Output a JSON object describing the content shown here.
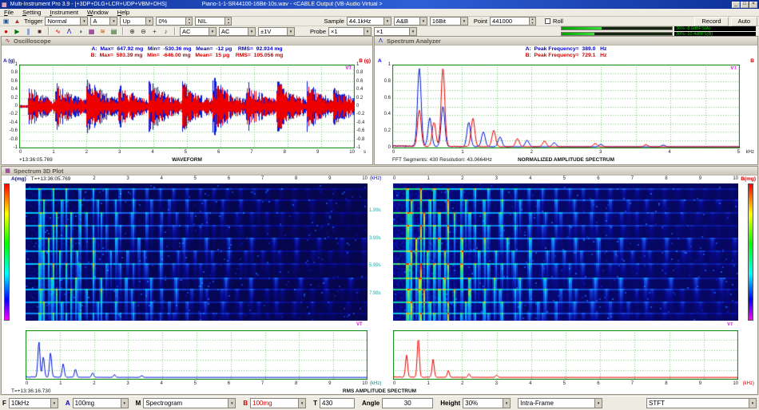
{
  "window": {
    "app_icon": "▦",
    "title": "Multi-Instrument Pro 3.9   - [+3DP+DLG+LCR+UDP+VBM+DHS]",
    "file": "Piano-1-1-SR44100-16Bit-10s.wav  - <CABLE Output (VB-Audio Virtual >",
    "min": "_",
    "max": "□",
    "close": "×"
  },
  "ui": {
    "dropdown_arrow": "▼",
    "spin_up": "▲",
    "spin_down": "▼"
  },
  "menu": {
    "items": [
      "File",
      "Setting",
      "Instrument",
      "Window",
      "Help"
    ]
  },
  "toolbar1": {
    "icons": [
      {
        "name": "audio-device",
        "glyph": "▣",
        "color": "#225588"
      },
      {
        "name": "trigger",
        "glyph": "▲",
        "color": "#aa3333"
      }
    ],
    "trigger_label": "Trigger",
    "mode": "Normal",
    "source": "A",
    "edge": "Up",
    "level": "0%",
    "delay": "NIL",
    "sample_label": "Sample",
    "rate": "44.1kHz",
    "channels": "A&B",
    "bits": "16Bit",
    "point_label": "Point",
    "points": "441000",
    "roll_label": "Roll",
    "record": "Record",
    "auto": "Auto"
  },
  "toolbar2": {
    "icons": [
      {
        "name": "record",
        "glyph": "●",
        "color": "#cc0000"
      },
      {
        "name": "play",
        "glyph": "▶",
        "color": "#007700"
      },
      {
        "name": "pause",
        "glyph": "∥",
        "color": "#0044bb"
      },
      {
        "name": "stop",
        "glyph": "■",
        "color": "#553333"
      },
      {
        "name": "oscilloscope",
        "glyph": "∿",
        "color": "#cc0000"
      },
      {
        "name": "spectrum-analyzer",
        "glyph": "Λ",
        "color": "#0000bb"
      },
      {
        "name": "multimeter",
        "glyph": "◑",
        "color": "#007777"
      },
      {
        "name": "spectrum-3d-plot",
        "glyph": "▦",
        "color": "#770077"
      },
      {
        "name": "signal-generator",
        "glyph": "≋",
        "color": "#bb5500"
      },
      {
        "name": "data-logger",
        "glyph": "▤",
        "color": "#005500"
      },
      {
        "name": "zoom-in",
        "glyph": "⊕",
        "color": "#333333"
      },
      {
        "name": "zoom-out",
        "glyph": "⊖",
        "color": "#333333"
      },
      {
        "name": "cursor",
        "glyph": "+",
        "color": "#333333"
      },
      {
        "name": "sound",
        "glyph": "♪",
        "color": "#333377"
      }
    ],
    "coupling_a": "AC",
    "coupling_b": "AC",
    "range": "±1V",
    "probe_label": "Probe",
    "probe_a": "×1",
    "probe_b": "×1",
    "meter_a_pct": 36,
    "meter_b_pct": 30,
    "meter_a": "36%:-8.9dBFS(A)",
    "meter_b": "30%:-10.4dBFS(B)"
  },
  "oscilloscope": {
    "title": "Oscilloscope",
    "icon": "∿",
    "stats_a": "A:  Max=  647.92 mg   Min=  -530.36 mg   Mean=  -12 μg    RMS=  92.934 mg",
    "stats_b": "B:  Max=  593.39 mg   Min=  -646.00 mg   Mean=  15 μg    RMS=  105.056 mg",
    "axis_a": "A (g)",
    "axis_b": "B (g)",
    "y_ticks": [
      "1",
      "0.8",
      "0.6",
      "0.4",
      "0.2",
      "0",
      "-0.2",
      "-0.4",
      "-0.6",
      "-0.8",
      "-1"
    ],
    "x_ticks": [
      "0",
      "1",
      "2",
      "3",
      "4",
      "5",
      "6",
      "7",
      "8",
      "9",
      "10"
    ],
    "x_unit": "s",
    "time_start": "+13:36:05.769",
    "x_title": "WAVEFORM",
    "watermark": "VT"
  },
  "spectrum_analyzer": {
    "title": "Spectrum Analyzer",
    "icon": "Λ",
    "stats_a": "A:  Peak Frequency=  389.0   Hz",
    "stats_b": "B:  Peak Frequency=  729.1   Hz",
    "axis_a": "A",
    "axis_b": "B",
    "y_ticks": [
      "1",
      "0.8",
      "0.6",
      "0.4",
      "0.2",
      "0"
    ],
    "x_ticks": [
      "0",
      "1",
      "2",
      "3",
      "4",
      "5"
    ],
    "x_unit": "kHz",
    "fft_info": "FFT Segments: 430    Resolution: 43.0664Hz",
    "x_title": "NORMALIZED AMPLITUDE SPECTRUM",
    "watermark": "VT"
  },
  "plot3d": {
    "title": "Spectrum 3D Plot",
    "icon": "▦",
    "a_label": "A(mg)",
    "b_label": "B(mg)",
    "time_start_label": "T=+13:36:05.769",
    "freq_ticks": [
      "0",
      "1",
      "2",
      "3",
      "4",
      "5",
      "6",
      "7",
      "8",
      "9",
      "10"
    ],
    "freq_unit": "(kHz)",
    "time_labels": [
      {
        "label": "1.99s",
        "pos": 0.2
      },
      {
        "label": "3.99s",
        "pos": 0.4
      },
      {
        "label": "5.99s",
        "pos": 0.6
      },
      {
        "label": "7.98s",
        "pos": 0.8
      }
    ],
    "rms_x_ticks": [
      "0",
      "1",
      "2",
      "3",
      "4",
      "5",
      "6",
      "7",
      "8",
      "9",
      "10"
    ],
    "rms_unit": "(kHz)",
    "time_end_label": "T=+13:36:16.730",
    "rms_title": "RMS AMPLITUDE SPECTRUM",
    "watermark": "VT"
  },
  "bottom": {
    "f_label": "F",
    "f_value": "10kHz",
    "a_label": "A",
    "a_value": "100mg",
    "a_color": "#0000cc",
    "m_label": "M",
    "m_value": "Spectrogram",
    "b_label": "B",
    "b_value": "100mg",
    "b_color": "#cc0000",
    "t_label": "T",
    "t_value": "430",
    "angle_label": "Angle",
    "angle_value": "30",
    "height_label": "Height",
    "height_value": "30%",
    "frame_value": "Intra-Frame",
    "method_value": "STFT"
  },
  "charts": {
    "waveform": {
      "seed": 7,
      "duration_s": 10,
      "base": 0.04,
      "decay": 1.6,
      "notes": [
        {
          "t": 0.25,
          "a": 0.5
        },
        {
          "t": 1.05,
          "a": 0.45
        },
        {
          "t": 2.0,
          "a": 0.58
        },
        {
          "t": 2.95,
          "a": 0.42
        },
        {
          "t": 3.85,
          "a": 0.52
        },
        {
          "t": 4.85,
          "a": 0.46
        },
        {
          "t": 5.75,
          "a": 0.6
        },
        {
          "t": 6.75,
          "a": 0.46
        },
        {
          "t": 7.65,
          "a": 0.55
        },
        {
          "t": 8.55,
          "a": 0.42
        },
        {
          "t": 9.35,
          "a": 0.32
        }
      ],
      "color_a": "#0018dd",
      "color_b": "#ee0000"
    },
    "spectrum": {
      "range_khz": 5,
      "color_a": "#0018dd",
      "color_b": "#ee0000",
      "a_peaks": [
        {
          "f": 389,
          "a": 0.97
        },
        {
          "f": 540,
          "a": 0.35
        },
        {
          "f": 729,
          "a": 0.5
        },
        {
          "f": 1100,
          "a": 0.3
        },
        {
          "f": 1310,
          "a": 0.18
        },
        {
          "f": 1550,
          "a": 0.12
        },
        {
          "f": 1940,
          "a": 0.08
        },
        {
          "f": 2330,
          "a": 0.05
        },
        {
          "f": 3000,
          "a": 0.03
        },
        {
          "f": 3900,
          "a": 0.02
        }
      ],
      "b_peaks": [
        {
          "f": 389,
          "a": 0.45
        },
        {
          "f": 600,
          "a": 0.3
        },
        {
          "f": 729,
          "a": 0.98
        },
        {
          "f": 1160,
          "a": 0.35
        },
        {
          "f": 1460,
          "a": 0.2
        },
        {
          "f": 1800,
          "a": 0.1
        },
        {
          "f": 2190,
          "a": 0.07
        },
        {
          "f": 2920,
          "a": 0.04
        },
        {
          "f": 3650,
          "a": 0.025
        }
      ]
    },
    "spectrogram": {
      "range_khz": 10,
      "duration_s": 10,
      "gain_a": 0.75,
      "gain_b": 1.15,
      "notes": [
        {
          "t": 0.25,
          "f0": 392,
          "a": 1.0
        },
        {
          "t": 1.05,
          "f0": 523,
          "a": 0.85
        },
        {
          "t": 2.0,
          "f0": 440,
          "a": 1.0
        },
        {
          "t": 2.95,
          "f0": 392,
          "a": 0.8
        },
        {
          "t": 3.85,
          "f0": 659,
          "a": 0.9
        },
        {
          "t": 4.85,
          "f0": 494,
          "a": 0.85
        },
        {
          "t": 5.75,
          "f0": 392,
          "a": 1.0
        },
        {
          "t": 6.75,
          "f0": 730,
          "a": 0.9
        },
        {
          "t": 7.65,
          "f0": 440,
          "a": 0.95
        },
        {
          "t": 8.55,
          "f0": 523,
          "a": 0.8
        },
        {
          "t": 9.35,
          "f0": 392,
          "a": 0.7
        }
      ]
    },
    "rms": {
      "range_khz": 10,
      "color_a": "#0018dd",
      "color_b": "#ee0000",
      "a_peaks": [
        {
          "f": 390,
          "a": 0.8
        },
        {
          "f": 520,
          "a": 0.45
        },
        {
          "f": 730,
          "a": 0.55
        },
        {
          "f": 1100,
          "a": 0.3
        },
        {
          "f": 1460,
          "a": 0.18
        },
        {
          "f": 1960,
          "a": 0.1
        },
        {
          "f": 2600,
          "a": 0.06
        },
        {
          "f": 3400,
          "a": 0.04
        }
      ],
      "b_peaks": [
        {
          "f": 390,
          "a": 0.5
        },
        {
          "f": 730,
          "a": 0.88
        },
        {
          "f": 1160,
          "a": 0.4
        },
        {
          "f": 1600,
          "a": 0.15
        },
        {
          "f": 2200,
          "a": 0.08
        },
        {
          "f": 3000,
          "a": 0.05
        }
      ]
    }
  }
}
